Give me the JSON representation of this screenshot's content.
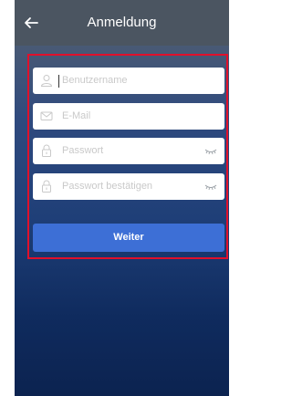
{
  "header": {
    "title": "Anmeldung",
    "back_icon": "arrow-left-icon"
  },
  "form": {
    "username_placeholder": "Benutzername",
    "email_placeholder": "E-Mail",
    "password_placeholder": "Passwort",
    "confirm_password_placeholder": "Passwort bestätigen",
    "submit_label": "Weiter"
  },
  "colors": {
    "header_bg": "#4b5561",
    "button_bg": "#3d6fd6",
    "highlight_border": "#e0102b"
  }
}
